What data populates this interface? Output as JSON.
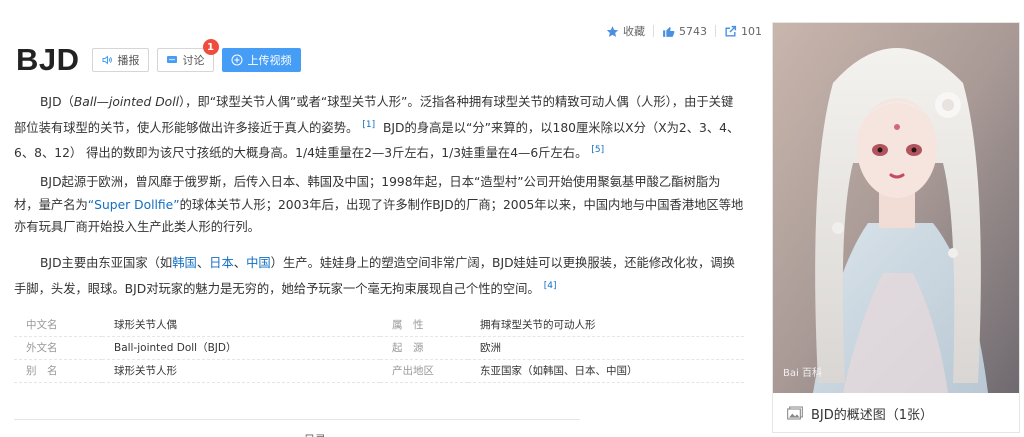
{
  "actions": {
    "favorite": "收藏",
    "likes": "5743",
    "shares": "101"
  },
  "title": "BJD",
  "buttons": {
    "broadcast": "播报",
    "discuss": "讨论",
    "discuss_badge": "1",
    "upload": "上传视频"
  },
  "paragraphs": {
    "p1": {
      "s1": "BJD（",
      "s1_italic": "Ball—jointed Doll",
      "s2": "），即“球型关节人偶”或者“球型关节人形”。泛指各种拥有球型关节的精致可动人偶（人形），由于关键部位装有球型的关节，使人形能够做出许多接近于真人的姿势。",
      "ref1": "[1]",
      "s3": " BJD的身高是以“分”来算的，以180厘米除以X分（X为2、3、4、6、8、12） 得出的数即为该尺寸孩纸的大概身高。1/4娃重量在2—3斤左右，1/3娃重量在4—6斤左右。",
      "ref2": "[5]"
    },
    "p2": {
      "s1": "BJD起源于欧洲，曾风靡于俄罗斯，后传入日本、韩国及中国；1998年起，日本“造型村”公司开始使用聚氨基甲酸乙酯树脂为材，量产名为",
      "link": "“Super Dollfie”",
      "s2": "的球体关节人形；2003年后，出现了许多制作BJD的厂商；2005年以来，中国内地与中国香港地区等地亦有玩具厂商开始投入生产此类人形的行列。"
    },
    "p3": {
      "s1": "BJD主要由东亚国家（如",
      "link1": "韩国",
      "sep1": "、",
      "link2": "日本",
      "sep2": "、",
      "link3": "中国",
      "s2": "）生产。娃娃身上的塑造空间非常广阔，BJD娃娃可以更换服装，还能修改化妆，调换手脚，头发，眼球。BJD对玩家的魅力是无穷的，她给予玩家一个毫无拘束展现自己个性的空间。",
      "ref": "[4]"
    }
  },
  "info": [
    {
      "k1": "中文名",
      "v1": "球形关节人偶",
      "k2": "属　性",
      "v2": "拥有球型关节的可动人形"
    },
    {
      "k1": "外文名",
      "v1": "Ball-jointed Doll（BJD）",
      "k2": "起　源",
      "v2": "欧洲"
    },
    {
      "k1": "别　名",
      "v1": "球形关节人形",
      "k2": "产出地区",
      "v2": "东亚国家（如韩国、日本、中国）"
    }
  ],
  "bottom_cut_text": "目录",
  "album": {
    "caption": "BJD的概述图（1张）",
    "watermark": "Bai 百科"
  },
  "colors": {
    "link": "#136ec2",
    "primary_button": "#459df5",
    "badge": "#f04c3d"
  }
}
